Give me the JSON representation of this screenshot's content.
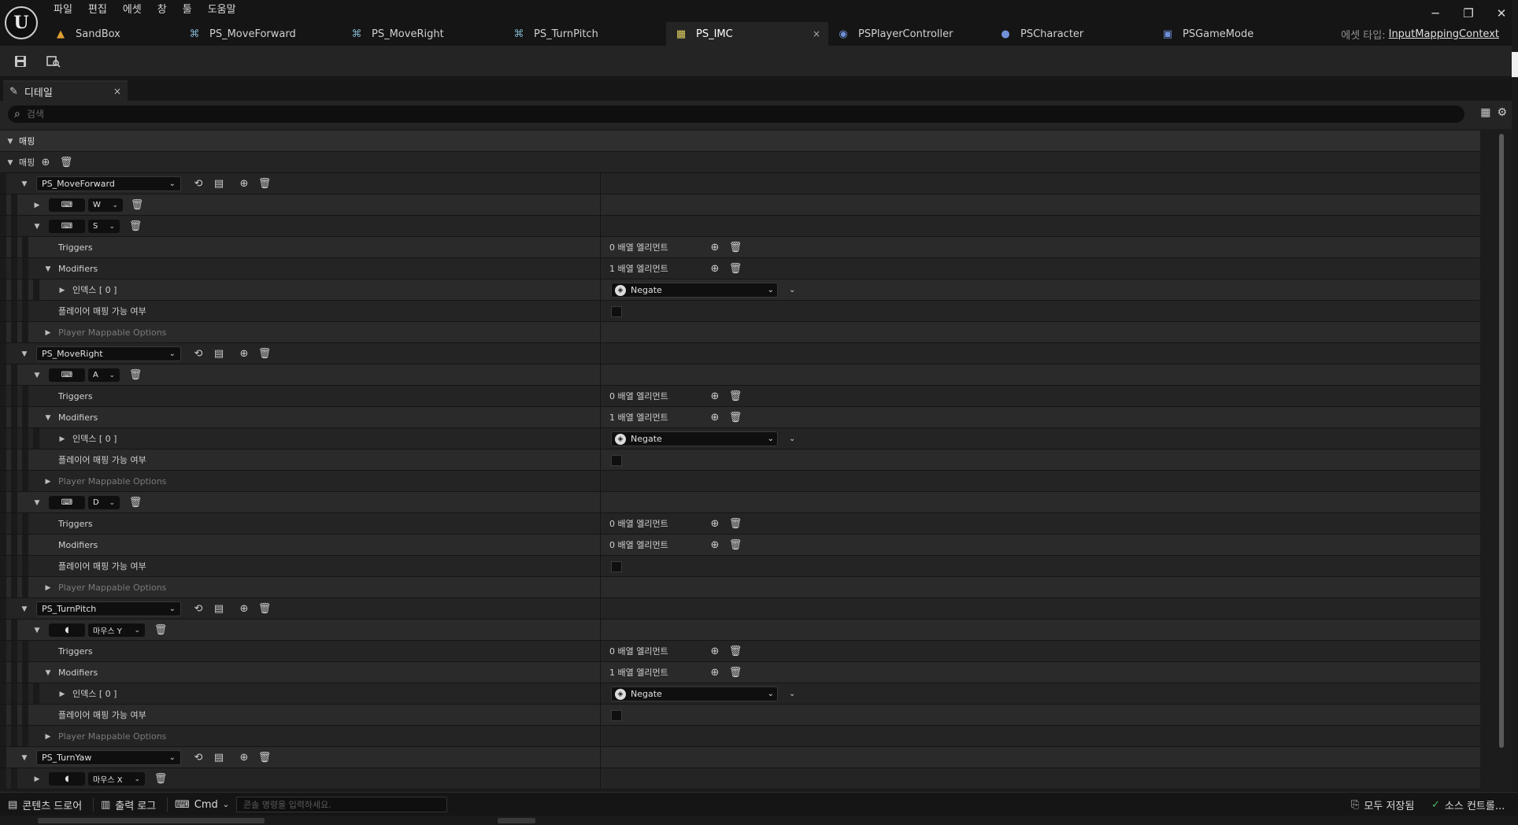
{
  "menu": [
    "파일",
    "편집",
    "에셋",
    "창",
    "툴",
    "도움말"
  ],
  "window_controls": {
    "minimize": "─",
    "maximize": "❐",
    "close": "✕"
  },
  "tabs": [
    {
      "label": "SandBox",
      "icon": "▲"
    },
    {
      "label": "PS_MoveForward",
      "icon": "⌘"
    },
    {
      "label": "PS_MoveRight",
      "icon": "⌘"
    },
    {
      "label": "PS_TurnPitch",
      "icon": "⌘"
    },
    {
      "label": "PS_IMC",
      "icon": "▦",
      "close": "×"
    },
    {
      "label": "PSPlayerController",
      "icon": "◉"
    },
    {
      "label": "PSCharacter",
      "icon": "●"
    },
    {
      "label": "PSGameMode",
      "icon": "▣"
    }
  ],
  "asset_type": {
    "label": "에셋 타입:",
    "value": "InputMappingContext"
  },
  "details_tab": {
    "label": "디테일",
    "close": "×"
  },
  "search": {
    "placeholder": "검색"
  },
  "section": {
    "label": "매핑"
  },
  "mappings_label": "매핑",
  "mappings": [
    {
      "action": "PS_MoveForward",
      "keys": [
        {
          "key": "W",
          "expanded": false
        },
        {
          "key": "S",
          "expanded": true,
          "triggers": "0 배열 엘리먼트",
          "modifiers": "1 배열 엘리먼트",
          "index": "인덱스 [ 0 ]",
          "modifier_value": "Negate",
          "player_mappable": "플레이어 매핑 가능 여부",
          "pmo": "Player Mappable Options"
        }
      ]
    },
    {
      "action": "PS_MoveRight",
      "keys": [
        {
          "key": "A",
          "expanded": true,
          "triggers": "0 배열 엘리먼트",
          "modifiers": "1 배열 엘리먼트",
          "index": "인덱스 [ 0 ]",
          "modifier_value": "Negate",
          "player_mappable": "플레이어 매핑 가능 여부",
          "pmo": "Player Mappable Options"
        },
        {
          "key": "D",
          "expanded": true,
          "triggers": "0 배열 엘리먼트",
          "modifiers": "0 배열 엘리먼트",
          "player_mappable": "플레이어 매핑 가능 여부",
          "pmo": "Player Mappable Options"
        }
      ]
    },
    {
      "action": "PS_TurnPitch",
      "keys": [
        {
          "key": "마우스 Y",
          "expanded": true,
          "triggers": "0 배열 엘리먼트",
          "modifiers": "1 배열 엘리먼트",
          "index": "인덱스 [ 0 ]",
          "modifier_value": "Negate",
          "player_mappable": "플레이어 매핑 가능 여부",
          "pmo": "Player Mappable Options"
        }
      ]
    },
    {
      "action": "PS_TurnYaw",
      "keys": [
        {
          "key": "마우스 X",
          "expanded": false
        }
      ]
    }
  ],
  "row_labels": {
    "triggers": "Triggers",
    "modifiers": "Modifiers"
  },
  "statusbar": {
    "content_drawer": "콘텐츠 드로어",
    "output_log": "출력 로그",
    "cmd": "Cmd",
    "console_placeholder": "콘솔 명령을 입력하세요.",
    "save_all": "모두 저장됨",
    "source_control": "소스 컨트롤..."
  },
  "colors": {
    "accent_bg": "#242424",
    "text": "#d0d0d0",
    "background": "#1a1a1a"
  }
}
